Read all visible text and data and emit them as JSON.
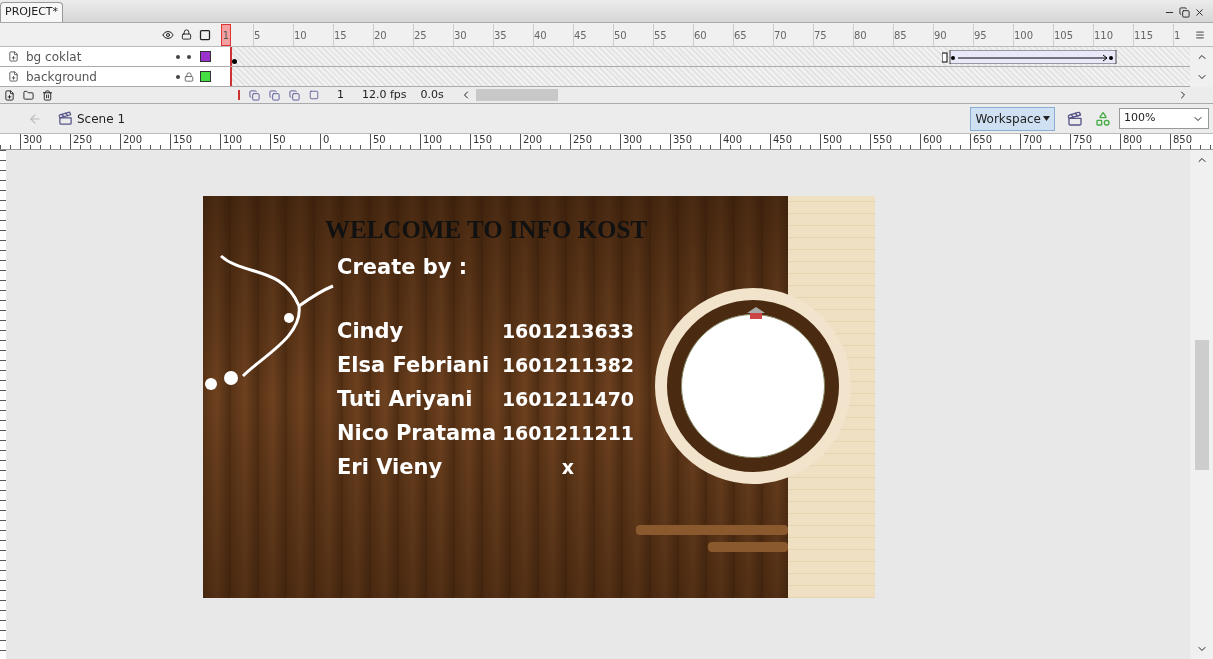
{
  "tab": {
    "label": "PROJECT*"
  },
  "timeline": {
    "frame_labels": [
      "1",
      "5",
      "10",
      "15",
      "20",
      "25",
      "30",
      "35",
      "40",
      "45",
      "50",
      "55",
      "60",
      "65",
      "70",
      "75",
      "80",
      "85",
      "90",
      "95",
      "100",
      "105",
      "110",
      "115",
      "1"
    ],
    "layers": [
      {
        "name": "bg coklat",
        "locked": false,
        "color": "#9933cc"
      },
      {
        "name": "background",
        "locked": true,
        "color": "#44dd44"
      }
    ],
    "current_frame": "1",
    "frame_rate": "12.0 fps",
    "elapsed": "0.0s"
  },
  "edit_bar": {
    "scene": "Scene 1",
    "workspace": "Workspace",
    "zoom": "100%"
  },
  "ruler": [
    "300",
    "250",
    "200",
    "150",
    "100",
    "50",
    "0",
    "50",
    "100",
    "150",
    "200",
    "250",
    "300",
    "350",
    "400",
    "450",
    "500",
    "550",
    "600",
    "650",
    "700",
    "750",
    "800",
    "850"
  ],
  "stage": {
    "title": "WELCOME TO INFO KOST",
    "subtitle": "Create by :",
    "members": [
      {
        "name": "Cindy",
        "id": "1601213633"
      },
      {
        "name": "Elsa Febriani",
        "id": "1601211382"
      },
      {
        "name": "Tuti Ariyani",
        "id": "1601211470"
      },
      {
        "name": "Nico Pratama",
        "id": "1601211211"
      },
      {
        "name": "Eri Vieny",
        "id": "x"
      }
    ]
  }
}
